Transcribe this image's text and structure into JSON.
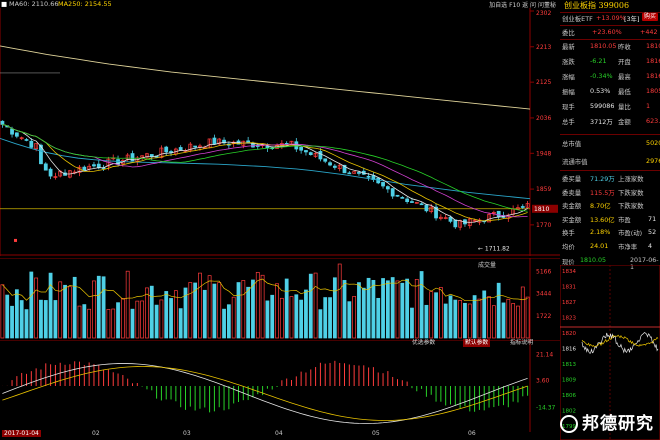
{
  "legend": {
    "ma60": "MA60: 2110.66",
    "ma250": "MA250: 2154.55"
  },
  "toolbar": {
    "buttons": [
      "加自选",
      "F10",
      "返",
      "问",
      "问董秘"
    ]
  },
  "quote": {
    "title": "创业板指 399006",
    "etf_label": "创业板ETF",
    "etf_change": "+13.09%",
    "etf_days": "[3年]",
    "buy_badge": "购买",
    "weibi_label": "委比",
    "weibi_value": "+23.60%",
    "weibi_right": "+442",
    "rows": [
      {
        "k1": "最新",
        "v1": "1810.05",
        "k2": "昨收",
        "v2": "1810",
        "c1": "red"
      },
      {
        "k1": "涨跌",
        "v1": "-6.21",
        "k2": "开盘",
        "v2": "1816",
        "c1": "green"
      },
      {
        "k1": "涨幅",
        "v1": "-0.34%",
        "k2": "最高",
        "v2": "1816",
        "c1": "green"
      },
      {
        "k1": "振幅",
        "v1": "0.53%",
        "k2": "最低",
        "v2": "1805",
        "c1": "white"
      },
      {
        "k1": "现手",
        "v1": "599086",
        "k2": "量比",
        "v2": "1",
        "c1": "white"
      },
      {
        "k1": "总手",
        "v1": "3712万",
        "k2": "金额",
        "v2": "623.",
        "c1": "white"
      }
    ],
    "zongshizhi_label": "总市值",
    "zongshizhi_value": "5020",
    "liutong_label": "流通市值",
    "liutong_value": "2976",
    "lower_rows": [
      {
        "k1": "委买量",
        "v1": "71.29万",
        "k2": "上涨家数",
        "v2": "",
        "c1": "cyan"
      },
      {
        "k1": "委卖量",
        "v1": "115.5万",
        "k2": "下跌家数",
        "v2": "",
        "c1": "red"
      },
      {
        "k1": "卖金额",
        "v1": "8.70亿",
        "k2": "下跌家数",
        "v2": "",
        "c1": "yellow"
      },
      {
        "k1": "买金额",
        "v1": "13.60亿",
        "k2": "市盈",
        "v2": "71",
        "c1": "yellow"
      },
      {
        "k1": "换手",
        "v1": "2.18%",
        "k2": "市盈(动)",
        "v2": "52",
        "c1": "yellow"
      },
      {
        "k1": "均价",
        "v1": "24.01",
        "k2": "市净率",
        "v2": "4",
        "c1": "yellow"
      }
    ]
  },
  "mini": {
    "label": "现价",
    "price": "1810.05",
    "date": "2017-06-1",
    "ticks": [
      "1834",
      "1831",
      "1827",
      "1823",
      "1820",
      "1816",
      "1813",
      "1809",
      "1806",
      "1802",
      "1799"
    ],
    "tick_colors": [
      "red",
      "red",
      "red",
      "red",
      "red",
      "white",
      "green",
      "green",
      "green",
      "green",
      "green"
    ]
  },
  "main_axis": [
    "2302",
    "2213",
    "2125",
    "2036",
    "1948",
    "1859",
    "1770"
  ],
  "main_axis_highlight": "1810",
  "low_label": "1711.82",
  "vol_axis": [
    "5166",
    "3444",
    "1722"
  ],
  "vol_header": "成交量",
  "macd_axis": [
    "21.14",
    "3.60",
    "-14.37",
    "-32.35"
  ],
  "macd_buttons": [
    "优选参数",
    "默认参数",
    "指标说明"
  ],
  "dates": [
    "2017-01-04",
    "02",
    "03",
    "04",
    "05",
    "06"
  ],
  "watermark": "邦德研究",
  "chart_data": {
    "type": "line",
    "ylim": [
      1700,
      2302
    ],
    "series": [
      {
        "name": "MA250",
        "values": [
          2215,
          2208,
          2201,
          2194,
          2188,
          2182,
          2176,
          2170,
          2165,
          2160,
          2155,
          2150,
          2146,
          2142,
          2138,
          2134,
          2130,
          2126,
          2122,
          2118,
          2114,
          2110,
          2106,
          2102,
          2098,
          2094,
          2090,
          2086,
          2082,
          2078,
          2074,
          2070,
          2066,
          2062,
          2058
        ]
      },
      {
        "name": "MA60",
        "values": [
          1985,
          1972,
          1960,
          1950,
          1942,
          1936,
          1932,
          1929,
          1927,
          1926,
          1925,
          1924,
          1923,
          1922,
          1921,
          1919,
          1917,
          1915,
          1912,
          1909,
          1905,
          1900,
          1895,
          1889,
          1883,
          1877,
          1871,
          1866,
          1861,
          1856,
          1851,
          1847,
          1843,
          1839,
          1835
        ]
      }
    ]
  }
}
